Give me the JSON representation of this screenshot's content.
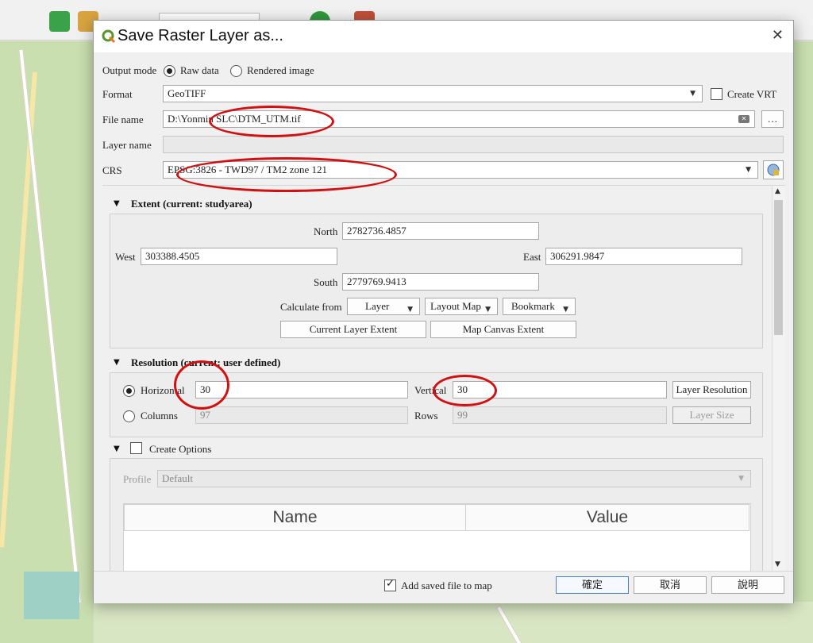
{
  "dialog": {
    "title": "Save Raster Layer as...",
    "close_glyph": "✕"
  },
  "output_mode": {
    "label": "Output mode",
    "raw_data": "Raw data",
    "rendered_image": "Rendered image",
    "selected": "raw_data"
  },
  "format": {
    "label": "Format",
    "value": "GeoTIFF",
    "create_vrt_label": "Create VRT",
    "create_vrt_checked": false
  },
  "file_name": {
    "label": "File name",
    "value": "D:\\Yonmin SLC\\DTM_UTM.tif",
    "browse_label": "…"
  },
  "layer_name": {
    "label": "Layer name",
    "value": ""
  },
  "crs": {
    "label": "CRS",
    "value": "EPSG:3826 - TWD97 / TM2 zone 121"
  },
  "extent": {
    "header": "Extent (current: studyarea)",
    "north_label": "North",
    "north": "2782736.4857",
    "west_label": "West",
    "west": "303388.4505",
    "east_label": "East",
    "east": "306291.9847",
    "south_label": "South",
    "south": "2779769.9413",
    "calc_from_label": "Calculate from",
    "layer_btn": "Layer",
    "layout_map_btn": "Layout Map",
    "bookmark_btn": "Bookmark",
    "current_layer_extent_btn": "Current Layer Extent",
    "map_canvas_extent_btn": "Map Canvas Extent"
  },
  "resolution": {
    "header": "Resolution (current: user defined)",
    "horizontal_label": "Horizontal",
    "horizontal": "30",
    "vertical_label": "Vertical",
    "vertical": "30",
    "layer_resolution_btn": "Layer Resolution",
    "columns_label": "Columns",
    "columns": "97",
    "rows_label": "Rows",
    "rows": "99",
    "layer_size_btn": "Layer Size",
    "selected": "horizontal"
  },
  "create_options": {
    "header": "Create Options",
    "checked": false,
    "profile_label": "Profile",
    "profile_value": "Default",
    "col_name": "Name",
    "col_value": "Value"
  },
  "footer": {
    "add_to_map_label": "Add saved file to map",
    "add_to_map_checked": true,
    "ok_btn": "確定",
    "cancel_btn": "取消",
    "help_btn": "說明"
  },
  "colors": {
    "annotation_red": "#d40f0f",
    "qgis_green": "#589632"
  }
}
